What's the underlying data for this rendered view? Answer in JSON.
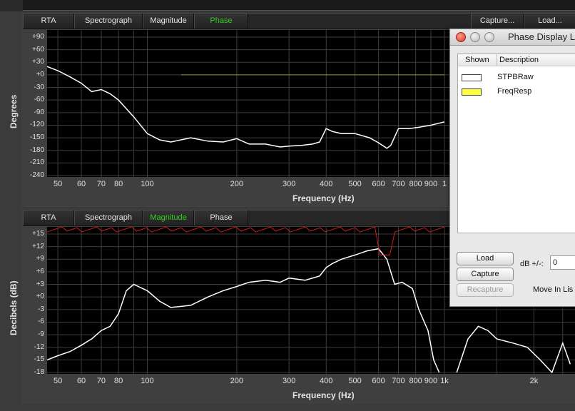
{
  "colors": {
    "active_tab": "#34d024",
    "grid": "#4a4a4a",
    "trace": "#ffffff",
    "ref_trace": "#d41a1a",
    "phase_ref": "#9acd32"
  },
  "top_panel": {
    "tabs": [
      {
        "label": "RTA",
        "active": false
      },
      {
        "label": "Spectrograph",
        "active": false
      },
      {
        "label": "Magnitude",
        "active": false
      },
      {
        "label": "Phase",
        "active": true
      }
    ],
    "capture_label": "Capture...",
    "load_label": "Load...",
    "y_axis_title": "Degrees",
    "x_axis_title": "Frequency (Hz)",
    "y_ticks": [
      "+90",
      "+60",
      "+30",
      "+0",
      "-30",
      "-60",
      "-90",
      "-120",
      "-150",
      "-180",
      "-210",
      "-240"
    ],
    "x_ticks": [
      "50",
      "60",
      "70",
      "80",
      "100",
      "200",
      "300",
      "400",
      "500",
      "600",
      "700",
      "800",
      "900",
      "1"
    ]
  },
  "bottom_panel": {
    "tabs": [
      {
        "label": "RTA",
        "active": false
      },
      {
        "label": "Spectrograph",
        "active": false
      },
      {
        "label": "Magnitude",
        "active": true
      },
      {
        "label": "Phase",
        "active": false
      }
    ],
    "y_axis_title": "Decibels (dB)",
    "x_axis_title": "Frequency (Hz)",
    "y_ticks": [
      "+15",
      "+12",
      "+9",
      "+6",
      "+3",
      "+0",
      "-3",
      "-6",
      "-9",
      "-12",
      "-15",
      "-18"
    ],
    "x_ticks": [
      "50",
      "60",
      "70",
      "80",
      "100",
      "200",
      "300",
      "400",
      "500",
      "600",
      "700",
      "800",
      "900",
      "1k",
      "2k"
    ]
  },
  "phase_window": {
    "title": "Phase Display L",
    "columns": {
      "shown": "Shown",
      "description": "Description"
    },
    "rows": [
      {
        "swatch": "#ffffff",
        "description": "STPBRaw"
      },
      {
        "swatch": "#ffff40",
        "description": "FreqResp"
      }
    ],
    "load_label": "Load",
    "capture_label": "Capture",
    "recapture_label": "Recapture",
    "db_label": "dB +/-:",
    "db_value": "0",
    "move_label": "Move In Lis"
  }
}
